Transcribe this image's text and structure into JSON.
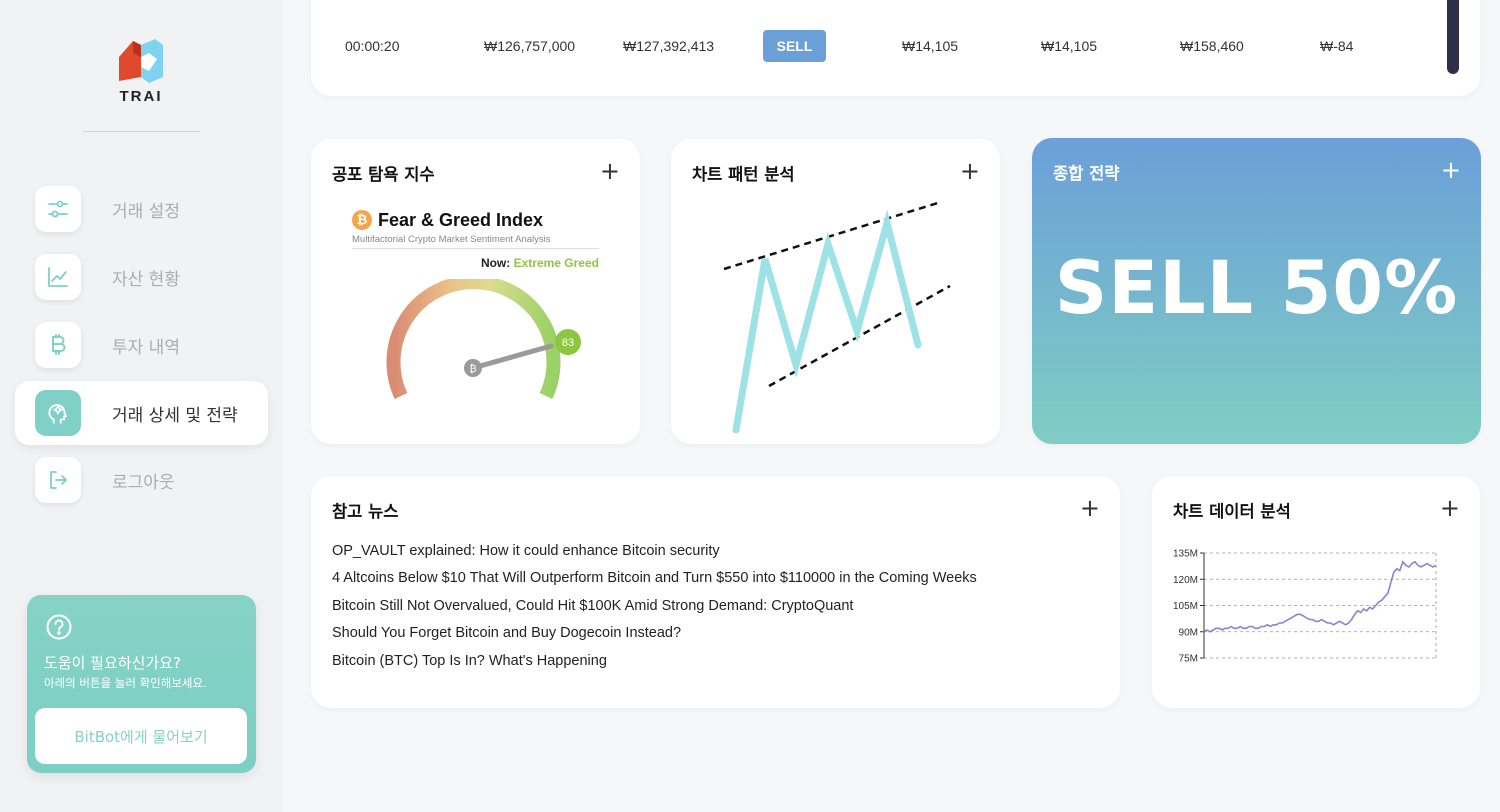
{
  "brand": {
    "name": "TRAI"
  },
  "sidebar": {
    "items": [
      {
        "label": "거래 설정",
        "icon": "sliders-icon",
        "active": false
      },
      {
        "label": "자산 현황",
        "icon": "line-chart-icon",
        "active": false
      },
      {
        "label": "투자 내역",
        "icon": "bitcoin-icon",
        "active": false
      },
      {
        "label": "거래 상세 및 전략",
        "icon": "brain-head-icon",
        "active": true
      },
      {
        "label": "로그아웃",
        "icon": "logout-icon",
        "active": false
      }
    ],
    "help": {
      "title": "도움이 필요하신가요?",
      "subtitle": "아래의 버튼을 눌러 확인해보세요.",
      "button": "BitBot에게 물어보기"
    }
  },
  "trade_row": {
    "time": "00:00:20",
    "col2": "₩126,757,000",
    "col3": "₩127,392,413",
    "action": "SELL",
    "col5": "₩14,105",
    "col6": "₩14,105",
    "col7": "₩158,460",
    "col8": "₩-84"
  },
  "fear_greed": {
    "title": "공포 탐욕 지수",
    "heading": "Fear & Greed Index",
    "subheading": "Multifactorial Crypto Market Sentiment Analysis",
    "now_label": "Now:",
    "now_value": "Extreme Greed",
    "score": "83"
  },
  "pattern": {
    "title": "차트 패턴 분석"
  },
  "strategy": {
    "title": "종합 전략",
    "value": "SELL 50%"
  },
  "news": {
    "title": "참고 뉴스",
    "items": [
      "OP_VAULT explained: How it could enhance Bitcoin security",
      "4 Altcoins Below $10 That Will Outperform Bitcoin and Turn $550 into $110000 in the Coming Weeks",
      "Bitcoin Still Not Overvalued, Could Hit $100K Amid Strong Demand: CryptoQuant",
      "Should You Forget Bitcoin and Buy Dogecoin Instead?",
      "Bitcoin (BTC) Top Is In? What's Happening"
    ]
  },
  "chart_panel": {
    "title": "차트 데이터 분석"
  },
  "chart_data": {
    "type": "line",
    "title": "",
    "xlabel": "",
    "ylabel": "",
    "ylim": [
      75,
      135
    ],
    "yticks": [
      "135M",
      "120M",
      "105M",
      "90M",
      "75M"
    ],
    "ytick_values": [
      135,
      120,
      105,
      90,
      75
    ],
    "grid": true,
    "series": [
      {
        "color": "#8c82d0",
        "values": [
          90,
          91,
          90,
          91,
          92,
          92,
          91,
          92,
          92,
          93,
          92,
          92,
          93,
          92,
          92,
          93,
          93,
          92,
          92,
          93,
          93,
          94,
          93,
          94,
          94,
          95,
          95,
          96,
          97,
          98,
          99,
          100,
          100,
          99,
          98,
          97,
          97,
          96,
          96,
          97,
          96,
          95,
          95,
          94,
          95,
          96,
          95,
          94,
          95,
          97,
          100,
          102,
          101,
          103,
          102,
          104,
          103,
          105,
          107,
          108,
          110,
          112,
          118,
          124,
          126,
          125,
          130,
          128,
          127,
          129,
          130,
          128,
          127,
          128,
          129,
          128,
          127,
          128
        ]
      }
    ]
  },
  "colors": {
    "accent": "#7fd0c6",
    "sell": "#6a9fd8",
    "pattern_line": "#9de3e6",
    "chart_line": "#8c82d0"
  }
}
